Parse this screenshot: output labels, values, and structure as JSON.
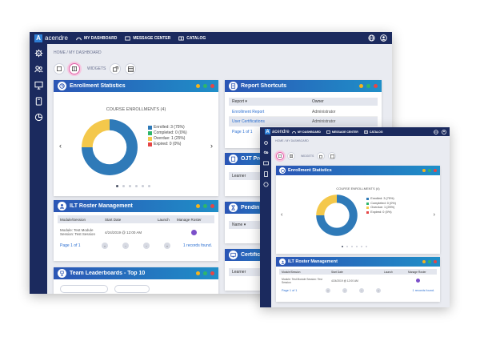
{
  "app": {
    "logo_text": "acendre"
  },
  "nav": {
    "dashboard": "MY DASHBOARD",
    "messages": "MESSAGE CENTER",
    "catalog": "CATALOG"
  },
  "breadcrumb": "HOME / MY DASHBOARD",
  "toolbar": {
    "widgets_label": "WIDGETS"
  },
  "colors": {
    "navy": "#1b2a5e",
    "enrolled": "#2f7ab8",
    "completed": "#2fb56b",
    "overdue": "#f4c84b",
    "expired": "#e54646"
  },
  "enrollment": {
    "title": "Enrollment Statistics",
    "chart_title": "COURSE ENROLLMENTS (4)",
    "chart_data": {
      "type": "pie",
      "categories": [
        "Enrolled",
        "Completed",
        "Overdue",
        "Expired"
      ],
      "values": [
        3,
        0,
        1,
        0
      ],
      "labels": [
        "Enrolled: 3 (75%)",
        "Completed: 0 (0%)",
        "Overdue: 1 (25%)",
        "Expired: 0 (0%)"
      ],
      "title": "COURSE ENROLLMENTS (4)"
    }
  },
  "ilt": {
    "title": "ILT Roster Management",
    "headers": [
      "Module/Session",
      "Start Date",
      "Launch",
      "Manage Roster"
    ],
    "row": {
      "module": "Module: Test Module Session: Test Session",
      "start": "4/24/2019 @ 12:00 AM"
    },
    "pager": "Page 1 of 1",
    "found": "1 records found."
  },
  "leaderboard": {
    "title": "Team Leaderboards - Top 10"
  },
  "shortcuts": {
    "title": "Report Shortcuts",
    "headers": [
      "Report",
      "Owner"
    ],
    "rows": [
      {
        "report": "Enrollment Report",
        "owner": "Administrator"
      },
      {
        "report": "User Certifications",
        "owner": "Administrator"
      }
    ],
    "pager": "Page 1 of 1"
  },
  "ojt": {
    "title": "OJT Pro"
  },
  "pending": {
    "title": "Pendin",
    "header": "Name"
  },
  "certs": {
    "title": "Certific",
    "header": "Learner"
  },
  "learner_header": "Learner"
}
